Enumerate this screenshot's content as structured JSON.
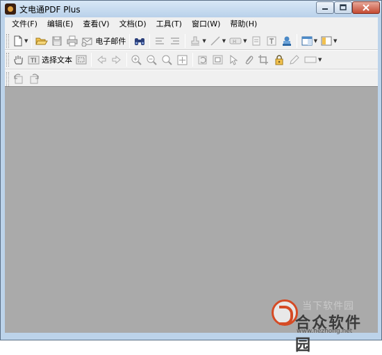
{
  "window": {
    "title": "文电通PDF Plus"
  },
  "menu": [
    {
      "label": "文件(F)"
    },
    {
      "label": "编辑(E)"
    },
    {
      "label": "查看(V)"
    },
    {
      "label": "文档(D)"
    },
    {
      "label": "工具(T)"
    },
    {
      "label": "窗口(W)"
    },
    {
      "label": "帮助(H)"
    }
  ],
  "toolbar": {
    "email_label": "电子邮件",
    "select_text_label": "选择文本"
  },
  "watermark": {
    "top_text": "当下软件园",
    "name": "合众软件园",
    "url": "www.hezhong.net"
  },
  "colors": {
    "document_background": "#aaaaaa",
    "title_bar": "#bcd3ea",
    "close_button": "#c44a32"
  }
}
